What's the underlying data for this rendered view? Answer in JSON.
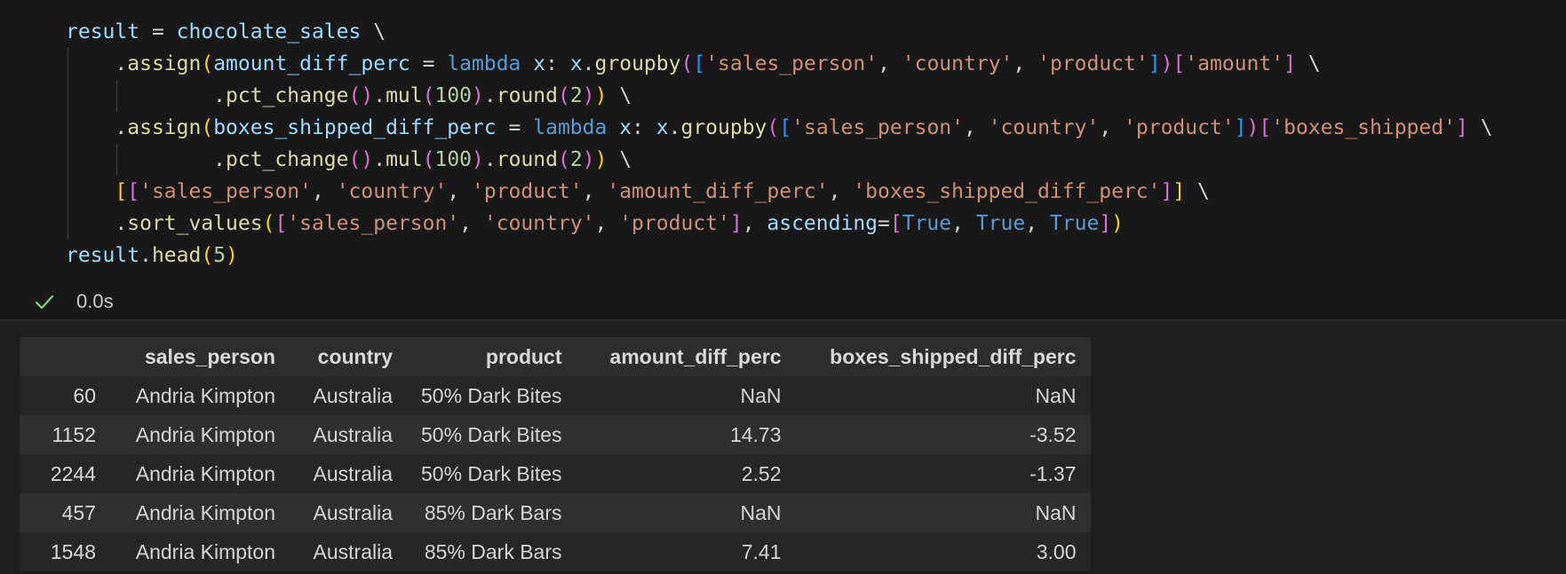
{
  "code": {
    "lines": [
      {
        "indent": 0,
        "guides": 0,
        "tokens": [
          {
            "t": "result",
            "c": "var"
          },
          {
            "t": " = ",
            "c": "op"
          },
          {
            "t": "chocolate_sales",
            "c": "var"
          },
          {
            "t": " \\",
            "c": "op"
          }
        ]
      },
      {
        "indent": 4,
        "guides": 1,
        "tokens": [
          {
            "t": ".",
            "c": "op"
          },
          {
            "t": "assign",
            "c": "fn"
          },
          {
            "t": "(",
            "c": "b1"
          },
          {
            "t": "amount_diff_perc",
            "c": "var"
          },
          {
            "t": " = ",
            "c": "op"
          },
          {
            "t": "lambda",
            "c": "kw"
          },
          {
            "t": " x",
            "c": "var"
          },
          {
            "t": ": ",
            "c": "op"
          },
          {
            "t": "x",
            "c": "var"
          },
          {
            "t": ".",
            "c": "op"
          },
          {
            "t": "groupby",
            "c": "fn"
          },
          {
            "t": "(",
            "c": "b2"
          },
          {
            "t": "[",
            "c": "b3"
          },
          {
            "t": "'sales_person'",
            "c": "str"
          },
          {
            "t": ", ",
            "c": "op"
          },
          {
            "t": "'country'",
            "c": "str"
          },
          {
            "t": ", ",
            "c": "op"
          },
          {
            "t": "'product'",
            "c": "str"
          },
          {
            "t": "]",
            "c": "b3"
          },
          {
            "t": ")",
            "c": "b2"
          },
          {
            "t": "[",
            "c": "b2"
          },
          {
            "t": "'amount'",
            "c": "str"
          },
          {
            "t": "]",
            "c": "b2"
          },
          {
            "t": " \\",
            "c": "op"
          }
        ]
      },
      {
        "indent": 12,
        "guides": 2,
        "tokens": [
          {
            "t": ".",
            "c": "op"
          },
          {
            "t": "pct_change",
            "c": "fn"
          },
          {
            "t": "()",
            "c": "b2"
          },
          {
            "t": ".",
            "c": "op"
          },
          {
            "t": "mul",
            "c": "fn"
          },
          {
            "t": "(",
            "c": "b2"
          },
          {
            "t": "100",
            "c": "num"
          },
          {
            "t": ")",
            "c": "b2"
          },
          {
            "t": ".",
            "c": "op"
          },
          {
            "t": "round",
            "c": "fn"
          },
          {
            "t": "(",
            "c": "b2"
          },
          {
            "t": "2",
            "c": "num"
          },
          {
            "t": ")",
            "c": "b2"
          },
          {
            "t": ")",
            "c": "b1"
          },
          {
            "t": " \\",
            "c": "op"
          }
        ]
      },
      {
        "indent": 4,
        "guides": 1,
        "tokens": [
          {
            "t": ".",
            "c": "op"
          },
          {
            "t": "assign",
            "c": "fn"
          },
          {
            "t": "(",
            "c": "b1"
          },
          {
            "t": "boxes_shipped_diff_perc",
            "c": "var"
          },
          {
            "t": " = ",
            "c": "op"
          },
          {
            "t": "lambda",
            "c": "kw"
          },
          {
            "t": " x",
            "c": "var"
          },
          {
            "t": ": ",
            "c": "op"
          },
          {
            "t": "x",
            "c": "var"
          },
          {
            "t": ".",
            "c": "op"
          },
          {
            "t": "groupby",
            "c": "fn"
          },
          {
            "t": "(",
            "c": "b2"
          },
          {
            "t": "[",
            "c": "b3"
          },
          {
            "t": "'sales_person'",
            "c": "str"
          },
          {
            "t": ", ",
            "c": "op"
          },
          {
            "t": "'country'",
            "c": "str"
          },
          {
            "t": ", ",
            "c": "op"
          },
          {
            "t": "'product'",
            "c": "str"
          },
          {
            "t": "]",
            "c": "b3"
          },
          {
            "t": ")",
            "c": "b2"
          },
          {
            "t": "[",
            "c": "b2"
          },
          {
            "t": "'boxes_shipped'",
            "c": "str"
          },
          {
            "t": "]",
            "c": "b2"
          },
          {
            "t": " \\",
            "c": "op"
          }
        ]
      },
      {
        "indent": 12,
        "guides": 2,
        "tokens": [
          {
            "t": ".",
            "c": "op"
          },
          {
            "t": "pct_change",
            "c": "fn"
          },
          {
            "t": "()",
            "c": "b2"
          },
          {
            "t": ".",
            "c": "op"
          },
          {
            "t": "mul",
            "c": "fn"
          },
          {
            "t": "(",
            "c": "b2"
          },
          {
            "t": "100",
            "c": "num"
          },
          {
            "t": ")",
            "c": "b2"
          },
          {
            "t": ".",
            "c": "op"
          },
          {
            "t": "round",
            "c": "fn"
          },
          {
            "t": "(",
            "c": "b2"
          },
          {
            "t": "2",
            "c": "num"
          },
          {
            "t": ")",
            "c": "b2"
          },
          {
            "t": ")",
            "c": "b1"
          },
          {
            "t": " \\",
            "c": "op"
          }
        ]
      },
      {
        "indent": 4,
        "guides": 1,
        "tokens": [
          {
            "t": "[",
            "c": "b1"
          },
          {
            "t": "[",
            "c": "b2"
          },
          {
            "t": "'sales_person'",
            "c": "str"
          },
          {
            "t": ", ",
            "c": "op"
          },
          {
            "t": "'country'",
            "c": "str"
          },
          {
            "t": ", ",
            "c": "op"
          },
          {
            "t": "'product'",
            "c": "str"
          },
          {
            "t": ", ",
            "c": "op"
          },
          {
            "t": "'amount_diff_perc'",
            "c": "str"
          },
          {
            "t": ", ",
            "c": "op"
          },
          {
            "t": "'boxes_shipped_diff_perc'",
            "c": "str"
          },
          {
            "t": "]",
            "c": "b2"
          },
          {
            "t": "]",
            "c": "b1"
          },
          {
            "t": " \\",
            "c": "op"
          }
        ]
      },
      {
        "indent": 4,
        "guides": 1,
        "tokens": [
          {
            "t": ".",
            "c": "op"
          },
          {
            "t": "sort_values",
            "c": "fn"
          },
          {
            "t": "(",
            "c": "b1"
          },
          {
            "t": "[",
            "c": "b2"
          },
          {
            "t": "'sales_person'",
            "c": "str"
          },
          {
            "t": ", ",
            "c": "op"
          },
          {
            "t": "'country'",
            "c": "str"
          },
          {
            "t": ", ",
            "c": "op"
          },
          {
            "t": "'product'",
            "c": "str"
          },
          {
            "t": "]",
            "c": "b2"
          },
          {
            "t": ", ",
            "c": "op"
          },
          {
            "t": "ascending",
            "c": "var"
          },
          {
            "t": "=",
            "c": "op"
          },
          {
            "t": "[",
            "c": "b2"
          },
          {
            "t": "True",
            "c": "kw"
          },
          {
            "t": ", ",
            "c": "op"
          },
          {
            "t": "True",
            "c": "kw"
          },
          {
            "t": ", ",
            "c": "op"
          },
          {
            "t": "True",
            "c": "kw"
          },
          {
            "t": "]",
            "c": "b2"
          },
          {
            "t": ")",
            "c": "b1"
          }
        ]
      },
      {
        "indent": 0,
        "guides": 0,
        "tokens": [
          {
            "t": "result",
            "c": "var"
          },
          {
            "t": ".",
            "c": "op"
          },
          {
            "t": "head",
            "c": "fn"
          },
          {
            "t": "(",
            "c": "b1"
          },
          {
            "t": "5",
            "c": "num"
          },
          {
            "t": ")",
            "c": "b1"
          }
        ]
      }
    ]
  },
  "status": {
    "icon": "check-icon",
    "time": "0.0s",
    "color": "#89d185"
  },
  "table": {
    "columns": [
      "",
      "sales_person",
      "country",
      "product",
      "amount_diff_perc",
      "boxes_shipped_diff_perc"
    ],
    "rows": [
      [
        "60",
        "Andria Kimpton",
        "Australia",
        "50% Dark Bites",
        "NaN",
        "NaN"
      ],
      [
        "1152",
        "Andria Kimpton",
        "Australia",
        "50% Dark Bites",
        "14.73",
        "-3.52"
      ],
      [
        "2244",
        "Andria Kimpton",
        "Australia",
        "50% Dark Bites",
        "2.52",
        "-1.37"
      ],
      [
        "457",
        "Andria Kimpton",
        "Australia",
        "85% Dark Bars",
        "NaN",
        "NaN"
      ],
      [
        "1548",
        "Andria Kimpton",
        "Australia",
        "85% Dark Bars",
        "7.41",
        "3.00"
      ]
    ]
  }
}
